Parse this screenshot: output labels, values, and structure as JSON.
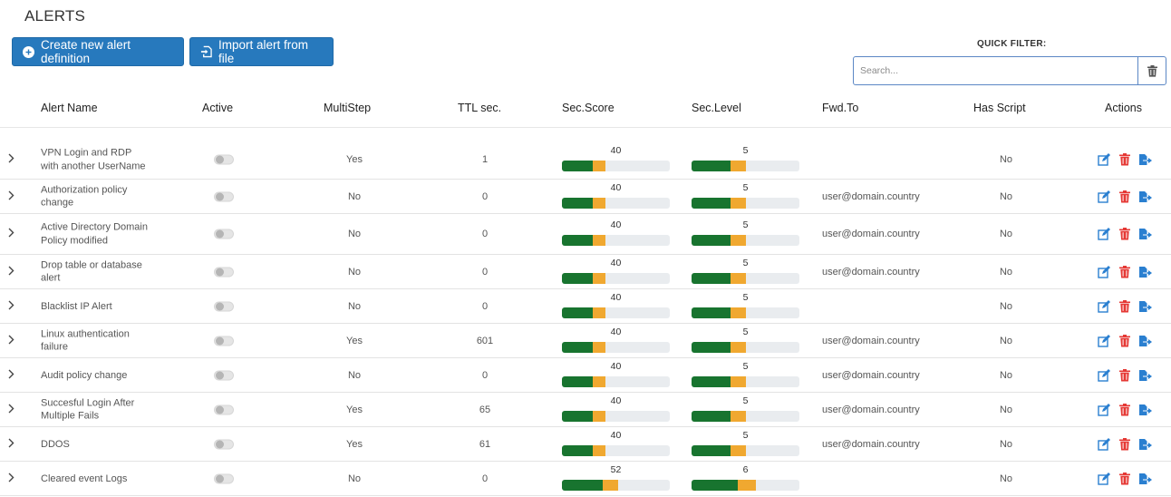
{
  "page": {
    "title": "ALERTS"
  },
  "toolbar": {
    "create_label": "Create new alert definition",
    "import_label": "Import alert from file"
  },
  "quick_filter": {
    "label": "QUICK FILTER:",
    "placeholder": "Search..."
  },
  "table": {
    "headers": {
      "name": "Alert Name",
      "active": "Active",
      "multistep": "MultiStep",
      "ttl": "TTL sec.",
      "score": "Sec.Score",
      "level": "Sec.Level",
      "fwd": "Fwd.To",
      "script": "Has Script",
      "actions": "Actions"
    },
    "rows": [
      {
        "name": "VPN Login and RDP with another UserName",
        "active": false,
        "multistep": "Yes",
        "ttl": "1",
        "score": "40",
        "level": "5",
        "fwd": "",
        "script": "No"
      },
      {
        "name": "Authorization policy change",
        "active": false,
        "multistep": "No",
        "ttl": "0",
        "score": "40",
        "level": "5",
        "fwd": "user@domain.country",
        "script": "No"
      },
      {
        "name": "Active Directory Domain Policy modified",
        "active": false,
        "multistep": "No",
        "ttl": "0",
        "score": "40",
        "level": "5",
        "fwd": "user@domain.country",
        "script": "No"
      },
      {
        "name": "Drop table or database alert",
        "active": false,
        "multistep": "No",
        "ttl": "0",
        "score": "40",
        "level": "5",
        "fwd": "user@domain.country",
        "script": "No"
      },
      {
        "name": "Blacklist IP Alert",
        "active": false,
        "multistep": "No",
        "ttl": "0",
        "score": "40",
        "level": "5",
        "fwd": "",
        "script": "No"
      },
      {
        "name": "Linux authentication failure",
        "active": false,
        "multistep": "Yes",
        "ttl": "601",
        "score": "40",
        "level": "5",
        "fwd": "user@domain.country",
        "script": "No"
      },
      {
        "name": "Audit policy change",
        "active": false,
        "multistep": "No",
        "ttl": "0",
        "score": "40",
        "level": "5",
        "fwd": "user@domain.country",
        "script": "No"
      },
      {
        "name": "Succesful Login After Multiple Fails",
        "active": false,
        "multistep": "Yes",
        "ttl": "65",
        "score": "40",
        "level": "5",
        "fwd": "user@domain.country",
        "script": "No"
      },
      {
        "name": "DDOS",
        "active": false,
        "multistep": "Yes",
        "ttl": "61",
        "score": "40",
        "level": "5",
        "fwd": "user@domain.country",
        "script": "No"
      },
      {
        "name": "Cleared event Logs",
        "active": false,
        "multistep": "No",
        "ttl": "0",
        "score": "52",
        "level": "6",
        "fwd": "",
        "script": "No"
      }
    ]
  },
  "icons": {
    "create": "plus-circle-icon",
    "import": "import-file-icon",
    "clear": "trash-icon",
    "edit": "edit-icon",
    "delete": "trash-icon",
    "export": "export-icon"
  },
  "colors": {
    "primary": "#2779bd",
    "bar_green": "#18742f",
    "bar_orange": "#f0a830",
    "bar_track": "#e9ecef",
    "delete_red": "#e53935"
  }
}
